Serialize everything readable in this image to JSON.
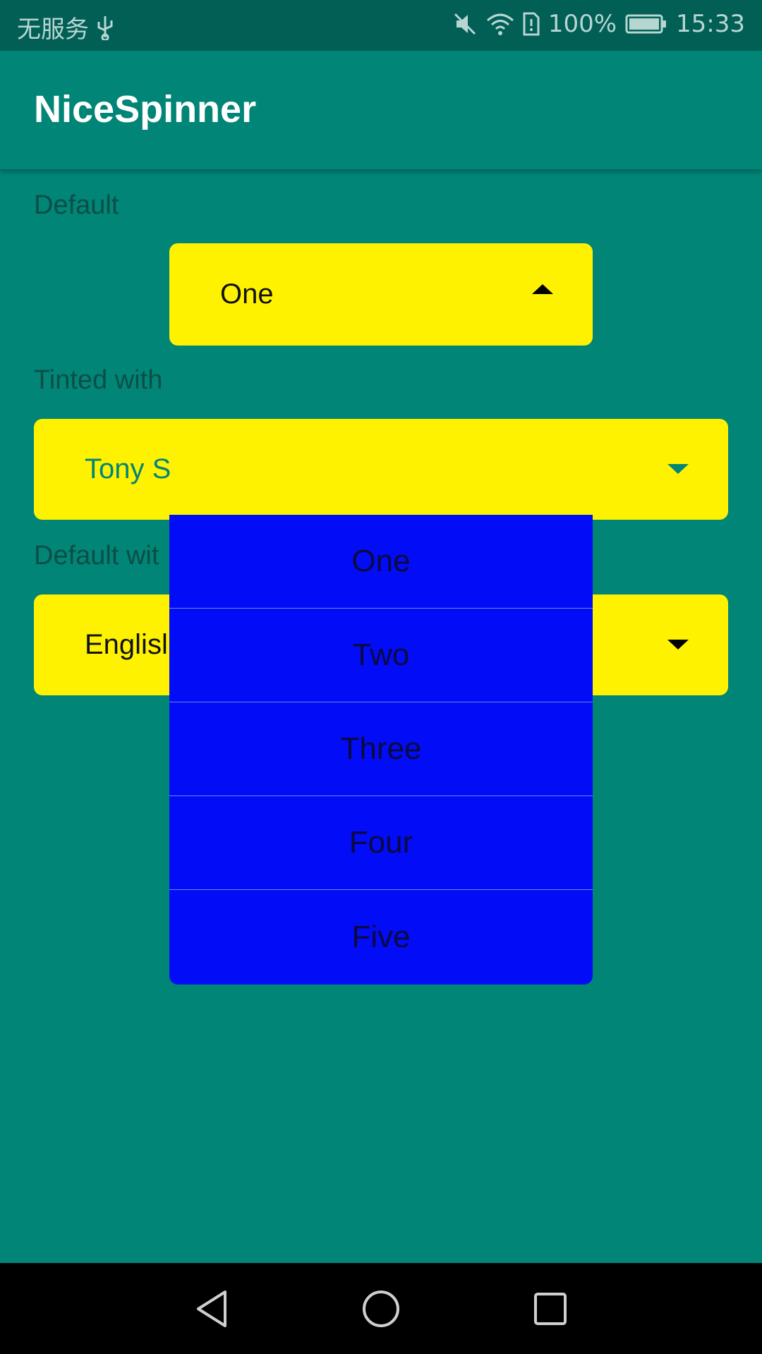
{
  "status_bar": {
    "carrier": "无服务",
    "battery": "100%",
    "time": "15:33",
    "icons": [
      "usb-icon",
      "mute-icon",
      "wifi-icon",
      "sim-alert-icon",
      "battery-icon"
    ]
  },
  "app_bar": {
    "title": "NiceSpinner"
  },
  "sections": {
    "default_label": "Default",
    "tinted_label": "Tinted with",
    "default_with_label": "Default wit"
  },
  "spinners": {
    "default": {
      "value": "One",
      "arrow": "up"
    },
    "tinted": {
      "value": "Tony S",
      "arrow": "down",
      "text_color": "#018577"
    },
    "language": {
      "value": "Englisl",
      "arrow": "down"
    }
  },
  "dropdown": {
    "items": [
      "One",
      "Two",
      "Three",
      "Four",
      "Five"
    ],
    "background": "#020cf7"
  },
  "colors": {
    "primary": "#018577",
    "status_bar": "#015f56",
    "spinner_bg": "#fff200"
  },
  "nav_bar": {
    "buttons": [
      "back-icon",
      "home-icon",
      "recents-icon"
    ]
  }
}
